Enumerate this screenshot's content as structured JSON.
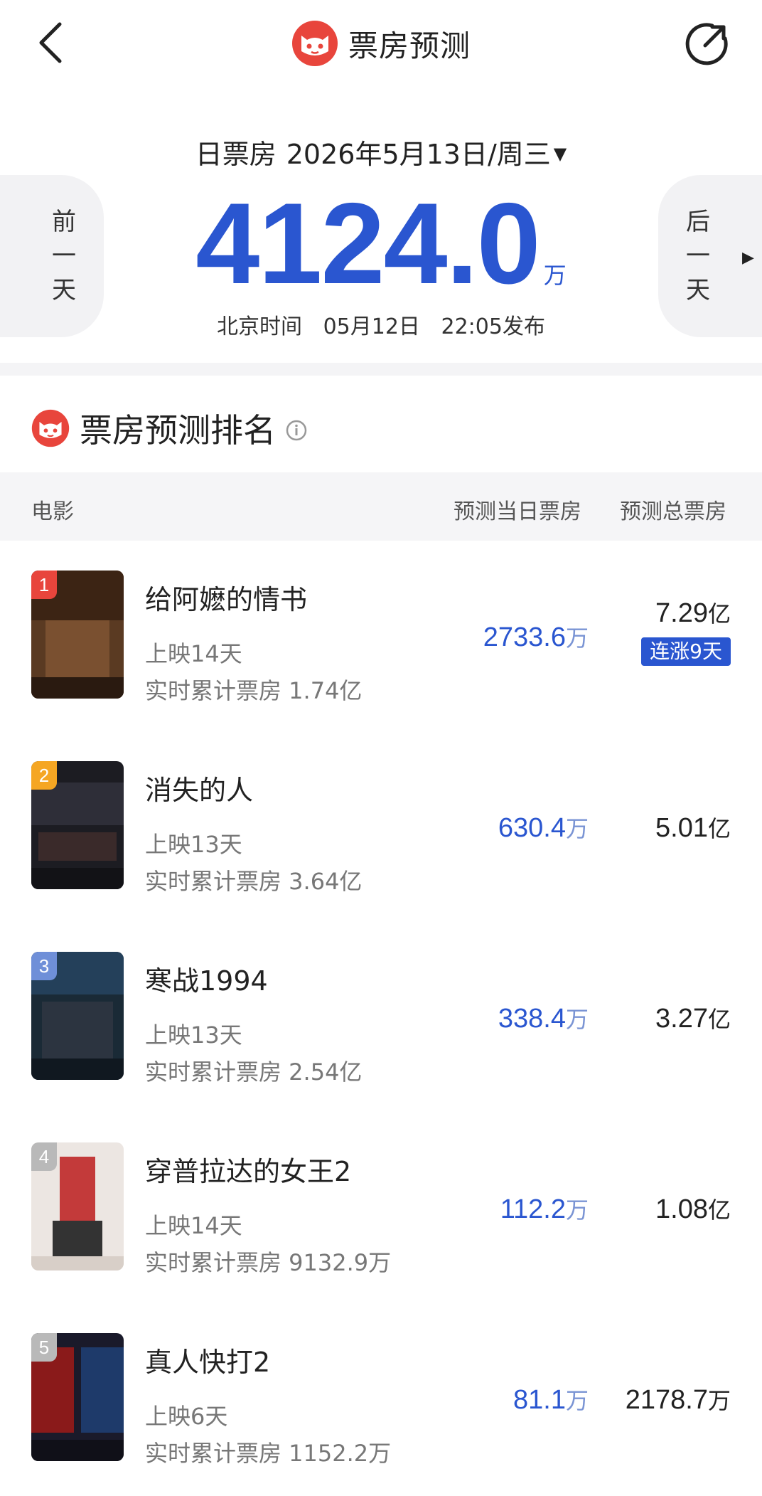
{
  "nav": {
    "title": "票房预测"
  },
  "hero": {
    "label": "日票房",
    "date": "2026年5月13日/周三",
    "caret": "▼",
    "prev_label": [
      "前",
      "一",
      "天"
    ],
    "next_label": [
      "后",
      "一",
      "天"
    ],
    "value": "4124.0",
    "unit": "万",
    "publish_prefix": "北京时间",
    "publish_date": "05月12日",
    "publish_time": "22:05发布"
  },
  "ranking": {
    "title": "票房预测排名",
    "headers": {
      "movie": "电影",
      "today": "预测当日票房",
      "total": "预测总票房"
    },
    "movies": [
      {
        "rank": "1",
        "title": "给阿嬷的情书",
        "days": "上映14天",
        "cumulative": "实时累计票房 1.74亿",
        "today_value": "2733.6",
        "today_unit": "万",
        "total_value": "7.29",
        "total_unit": "亿",
        "badge": "连涨9天",
        "rank_color": "#e8453c"
      },
      {
        "rank": "2",
        "title": "消失的人",
        "days": "上映13天",
        "cumulative": "实时累计票房 3.64亿",
        "today_value": "630.4",
        "today_unit": "万",
        "total_value": "5.01",
        "total_unit": "亿",
        "rank_color": "#f5a623"
      },
      {
        "rank": "3",
        "title": "寒战1994",
        "days": "上映13天",
        "cumulative": "实时累计票房 2.54亿",
        "today_value": "338.4",
        "today_unit": "万",
        "total_value": "3.27",
        "total_unit": "亿",
        "rank_color": "#6f8fd8"
      },
      {
        "rank": "4",
        "title": "穿普拉达的女王2",
        "days": "上映14天",
        "cumulative": "实时累计票房 9132.9万",
        "today_value": "112.2",
        "today_unit": "万",
        "total_value": "1.08",
        "total_unit": "亿",
        "rank_color": "#b9b9b9"
      },
      {
        "rank": "5",
        "title": "真人快打2",
        "days": "上映6天",
        "cumulative": "实时累计票房 1152.2万",
        "today_value": "81.1",
        "today_unit": "万",
        "total_value": "2178.7",
        "total_unit": "万",
        "rank_color": "#b9b9b9"
      }
    ]
  }
}
